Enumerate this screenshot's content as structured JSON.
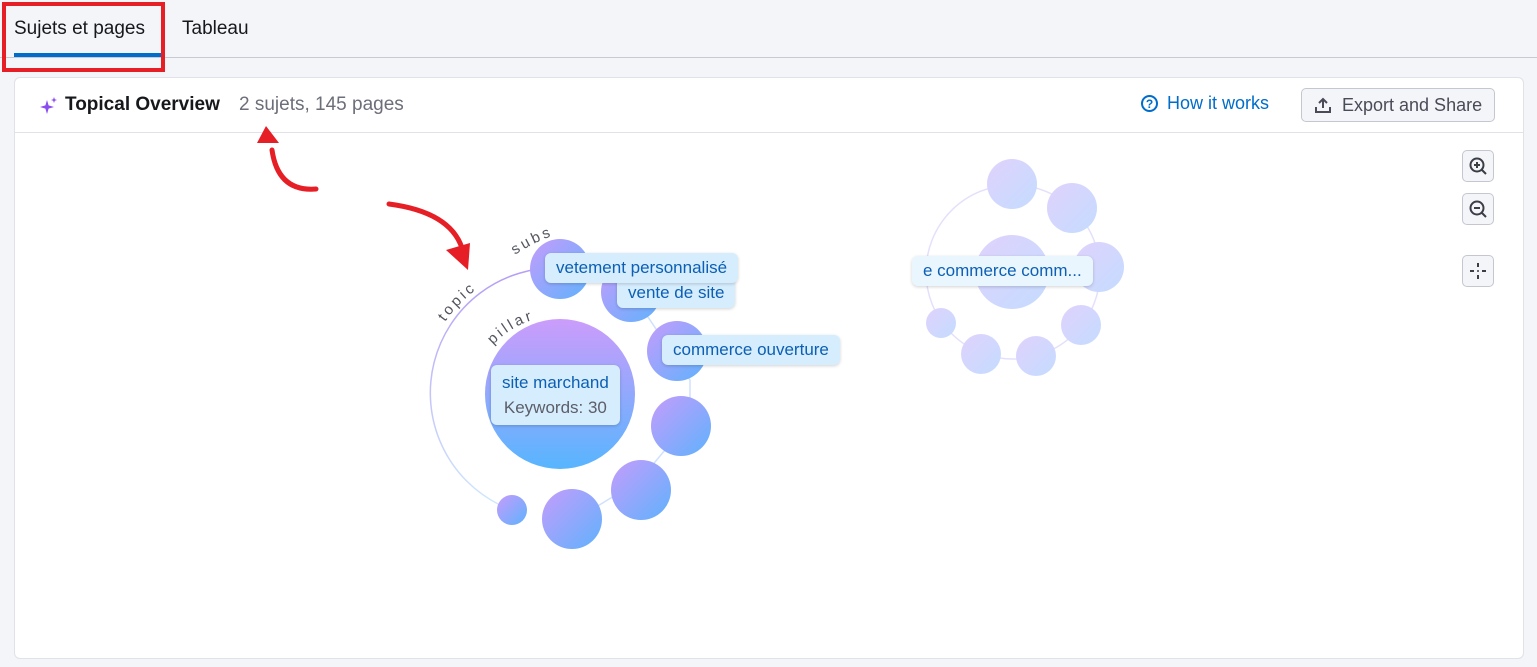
{
  "tabs": [
    {
      "label": "Sujets et pages",
      "active": true
    },
    {
      "label": "Tableau",
      "active": false
    }
  ],
  "header": {
    "icon": "sparkle-icon",
    "title": "Topical Overview",
    "subtitle": "2 sujets, 145 pages",
    "how_it_works": "How it works",
    "how_icon": "?",
    "export_label": "Export and Share"
  },
  "controls": [
    "zoom-in-icon",
    "zoom-out-icon",
    "recenter-icon"
  ],
  "colors": {
    "accent": "#006dca",
    "annotation": "#e61e25",
    "bubble_top": "#c79bfb",
    "bubble_bottom": "#5ab4fd"
  },
  "graph": {
    "ring_labels": {
      "subs": "subs",
      "topic": "topic",
      "pillar": "pillar"
    },
    "topic1": {
      "pillar_name": "site marchand",
      "pillar_keywords": "Keywords: 30",
      "subs": [
        "vetement personnalisé",
        "vente de site",
        "commerce ouverture"
      ]
    },
    "topic2": {
      "pillar_name": "e commerce comm..."
    }
  }
}
